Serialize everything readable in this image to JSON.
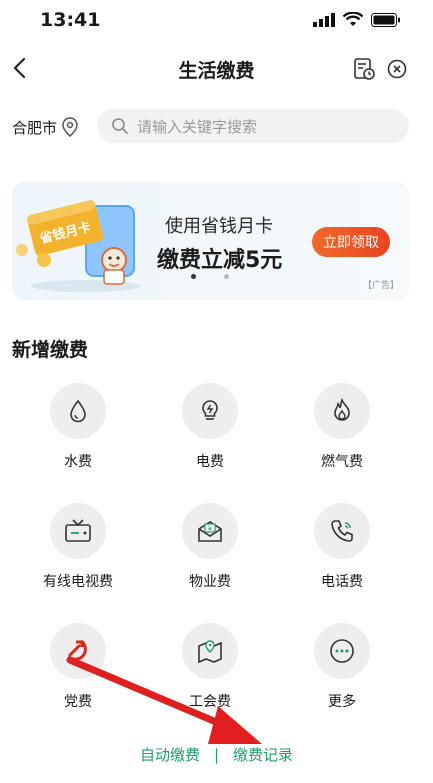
{
  "status": {
    "time": "13:41"
  },
  "header": {
    "title": "生活缴费"
  },
  "location": {
    "city": "合肥市"
  },
  "search": {
    "placeholder": "请输入关键字搜索"
  },
  "banner": {
    "line1": "使用省钱月卡",
    "line2": "缴费立减5元",
    "button": "立即领取",
    "ad": "【广告】",
    "card_text": "省钱月卡"
  },
  "section": {
    "title": "新增缴费"
  },
  "services": [
    {
      "label": "水费",
      "icon": "water-drop-icon"
    },
    {
      "label": "电费",
      "icon": "lightbulb-icon"
    },
    {
      "label": "燃气费",
      "icon": "flame-icon"
    },
    {
      "label": "有线电视费",
      "icon": "tv-icon"
    },
    {
      "label": "物业费",
      "icon": "property-envelope-icon"
    },
    {
      "label": "电话费",
      "icon": "phone-icon"
    },
    {
      "label": "党费",
      "icon": "party-emblem-icon"
    },
    {
      "label": "工会费",
      "icon": "map-pin-icon"
    },
    {
      "label": "更多",
      "icon": "more-dots-icon"
    }
  ],
  "bottom": {
    "auto_pay": "自动缴费",
    "separator": "|",
    "records": "缴费记录"
  },
  "colors": {
    "accent_green": "#1f9d6b",
    "arrow_red": "#e02020",
    "cta_orange": "#ee5a24"
  }
}
